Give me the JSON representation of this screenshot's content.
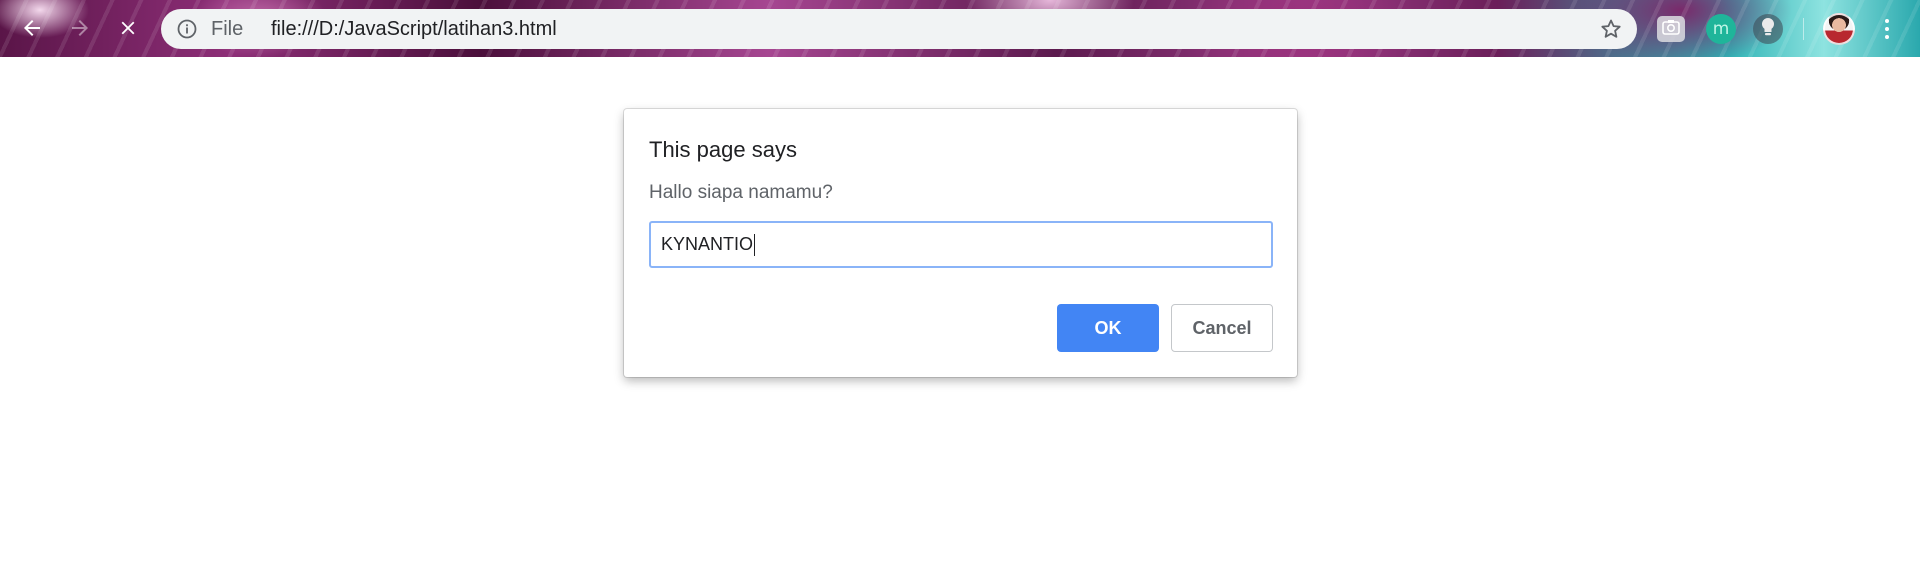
{
  "browser": {
    "nav": {
      "back_icon": "back-arrow-icon",
      "forward_icon": "forward-arrow-icon",
      "stop_icon": "close-icon"
    },
    "omnibox": {
      "scheme_label": "File",
      "url": "file:///D:/JavaScript/latihan3.html",
      "info_icon": "info-icon",
      "bookmark_icon": "star-icon"
    },
    "extensions": [
      {
        "icon": "camera-icon",
        "label": ""
      },
      {
        "icon": "m-extension-icon",
        "label": "m"
      },
      {
        "icon": "lightbulb-icon",
        "label": ""
      }
    ],
    "profile_icon": "avatar",
    "menu_icon": "more-vert-icon"
  },
  "dialog": {
    "title": "This page says",
    "message": "Hallo siapa namamu?",
    "input_value": "KYNANTIO",
    "ok_label": "OK",
    "cancel_label": "Cancel"
  },
  "colors": {
    "accent": "#4285f4",
    "input_border": "#8ab4f8",
    "omnibox_bg": "#f1f3f4"
  }
}
